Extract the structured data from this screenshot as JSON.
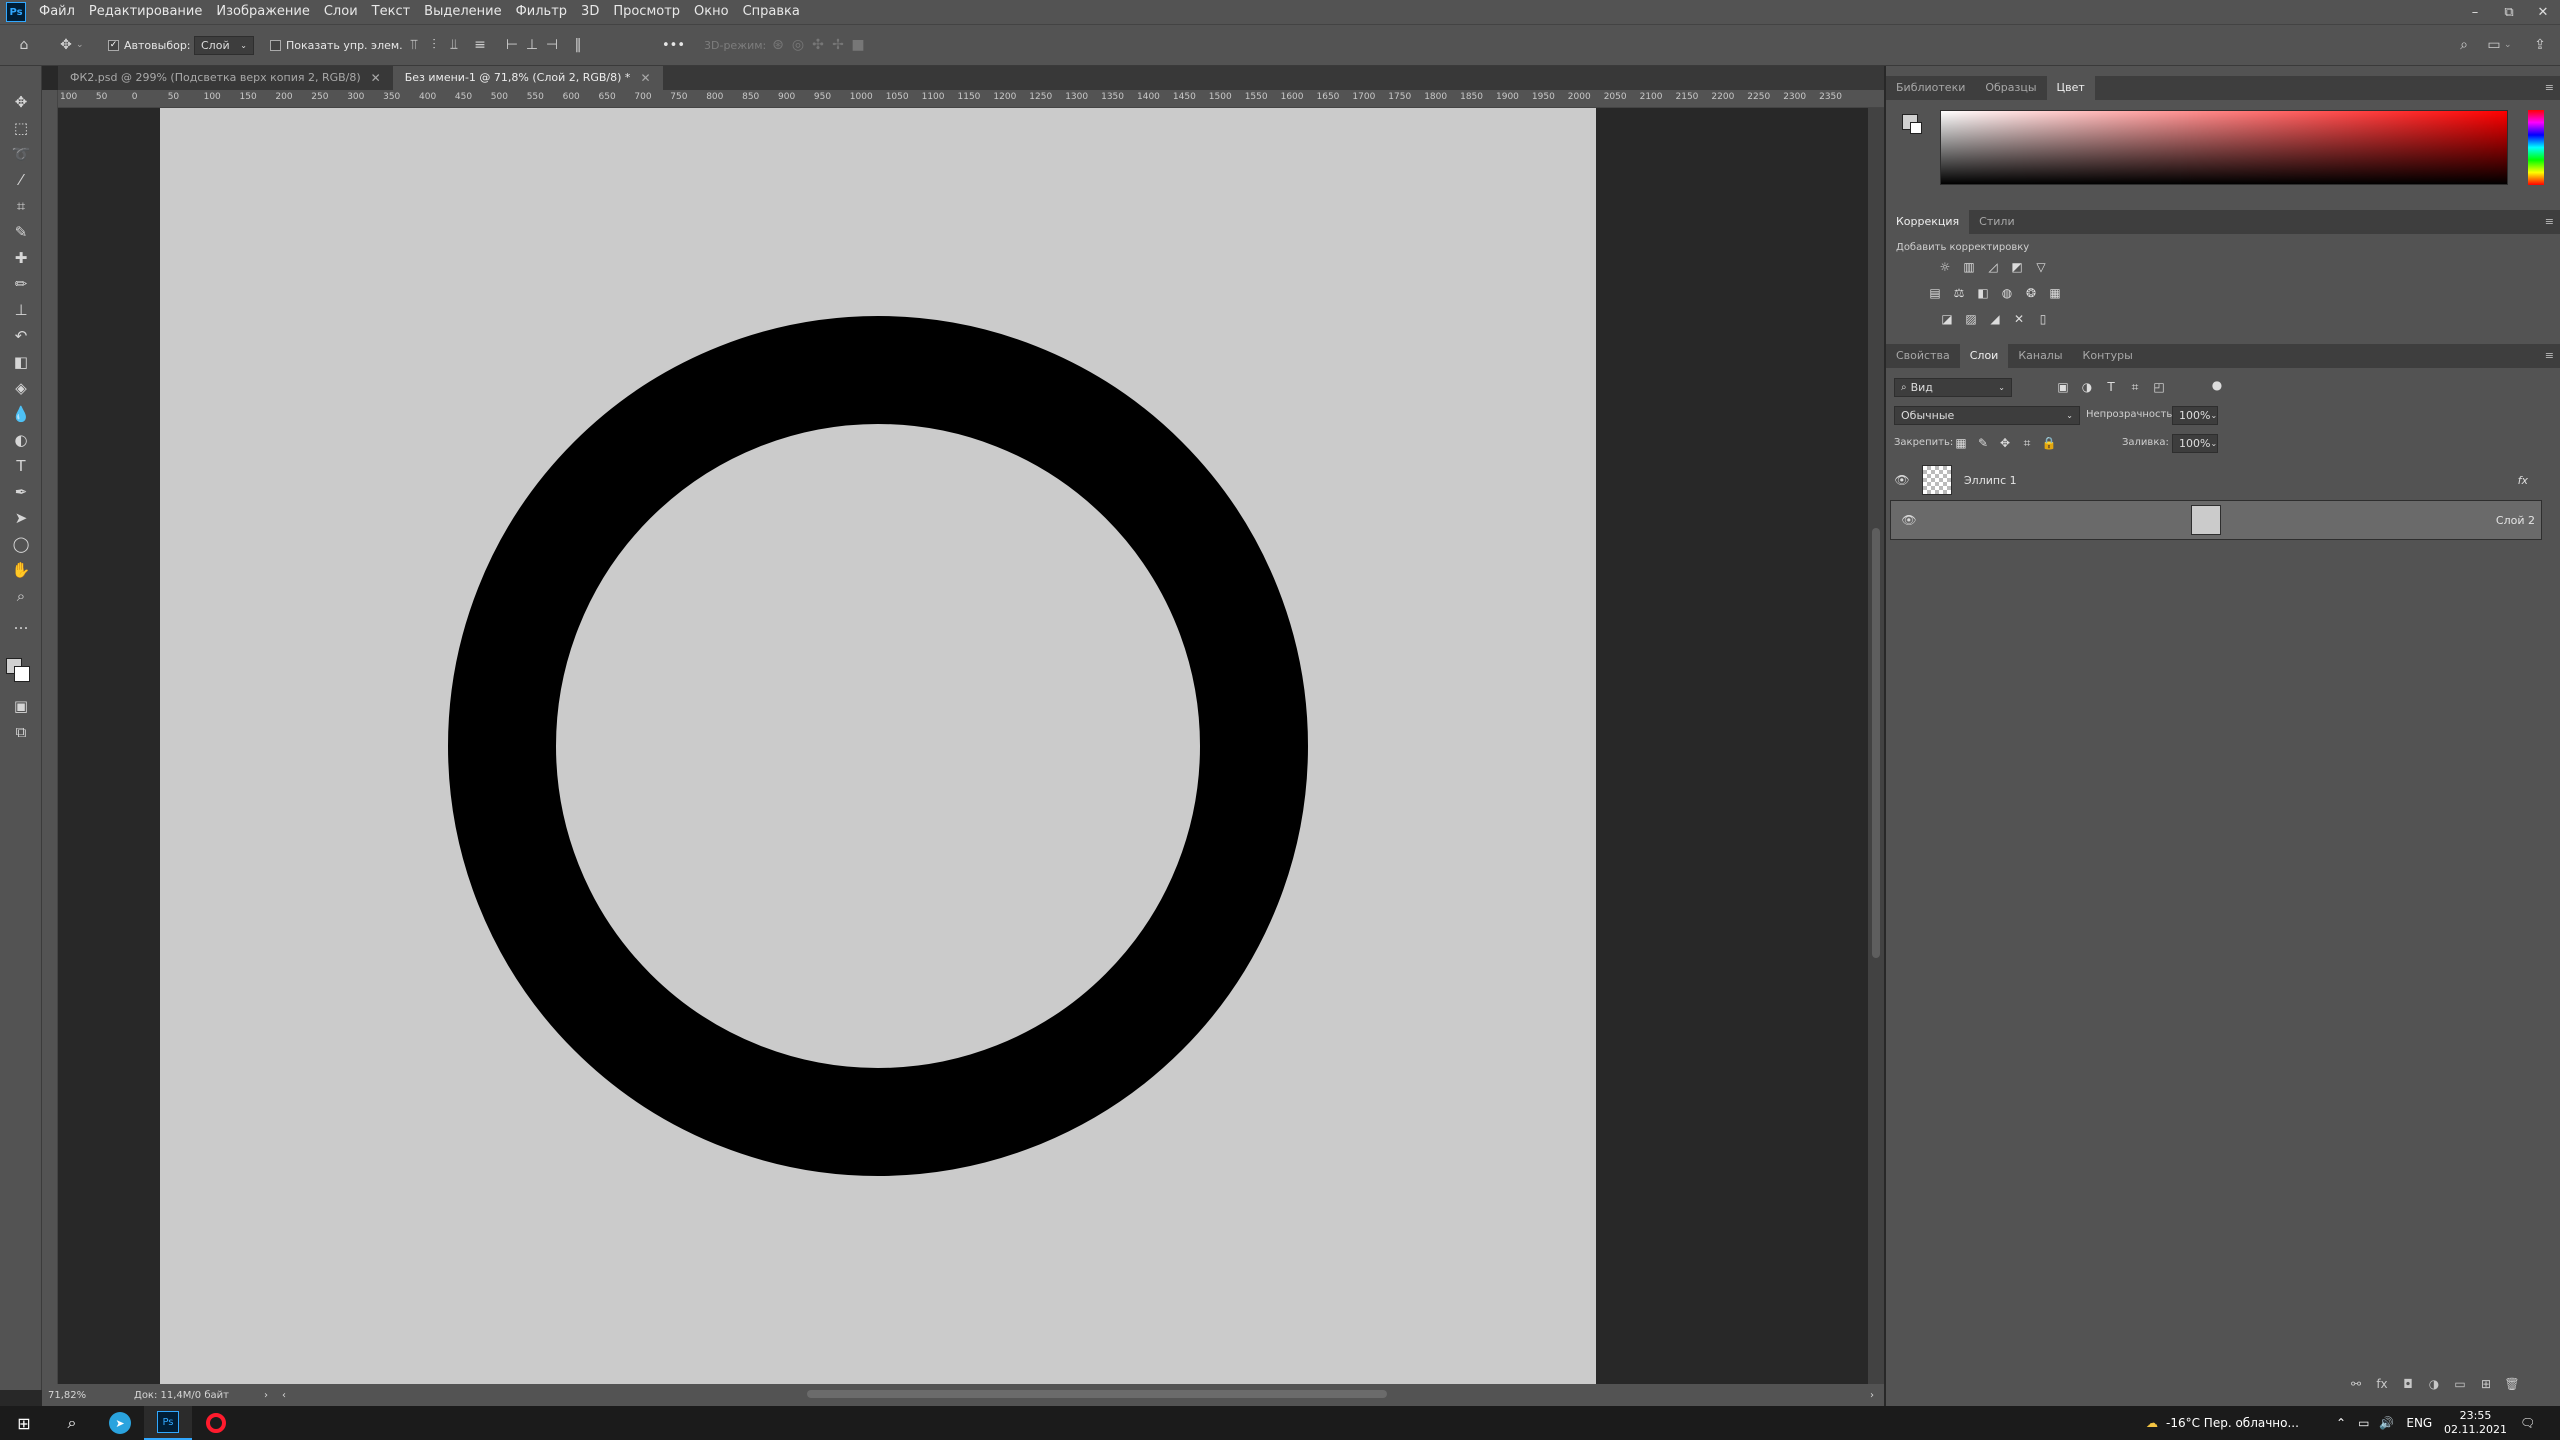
{
  "app": {
    "logo": "Ps",
    "accent": "#31a8ff"
  },
  "menu": [
    "Файл",
    "Редактирование",
    "Изображение",
    "Слои",
    "Текст",
    "Выделение",
    "Фильтр",
    "3D",
    "Просмотр",
    "Окно",
    "Справка"
  ],
  "window_controls": {
    "minimize": "–",
    "restore": "⧉",
    "close": "✕"
  },
  "options": {
    "autoselect_label": "Автовыбор:",
    "autoselect_checked": true,
    "autoselect_value": "Слой",
    "show_transform_label": "Показать упр. элем.",
    "more": "•••",
    "mode_3d": "3D-режим:"
  },
  "tabs": [
    {
      "label": "ФК2.psd @ 299% (Подсветка верх копия 2, RGB/8)",
      "active": false,
      "close": "✕"
    },
    {
      "label": "Без имени-1 @ 71,8% (Слой 2, RGB/8) *",
      "active": true,
      "close": "✕"
    }
  ],
  "ruler_h": [
    "100",
    "50",
    "0",
    "50",
    "100",
    "150",
    "200",
    "250",
    "300",
    "350",
    "400",
    "450",
    "500",
    "550",
    "600",
    "650",
    "700",
    "750",
    "800",
    "850",
    "900",
    "950",
    "1000",
    "1050",
    "1100",
    "1150",
    "1200",
    "1250",
    "1300",
    "1350",
    "1400",
    "1450",
    "1500",
    "1550",
    "1600",
    "1650",
    "1700",
    "1750",
    "1800",
    "1850",
    "1900",
    "1950",
    "2000",
    "2050",
    "2100",
    "2150",
    "2200",
    "2250",
    "2300",
    "2350"
  ],
  "document": {
    "background": "#cbcbcb",
    "ring_color": "#000000"
  },
  "status": {
    "zoom": "71,82%",
    "doc": "Док: 11,4M/0 байт",
    "arrow": "›",
    "left": "‹",
    "right": "›"
  },
  "panels": {
    "color_tabs": [
      {
        "label": "Библиотеки",
        "active": false
      },
      {
        "label": "Образцы",
        "active": false
      },
      {
        "label": "Цвет",
        "active": true
      }
    ],
    "foreground": "#d0d0d0",
    "background_swatch": "#ffffff",
    "adjust_tabs": [
      {
        "label": "Коррекция",
        "active": true
      },
      {
        "label": "Стили",
        "active": false
      }
    ],
    "adjust_hint": "Добавить корректировку",
    "layer_tabs": [
      {
        "label": "Свойства",
        "active": false
      },
      {
        "label": "Слои",
        "active": true
      },
      {
        "label": "Каналы",
        "active": false
      },
      {
        "label": "Контуры",
        "active": false
      }
    ],
    "filter_kind": "Вид",
    "blend_mode": "Обычные",
    "opacity_label": "Непрозрачность:",
    "opacity_value": "100%",
    "lock_label": "Закрепить:",
    "fill_label": "Заливка:",
    "fill_value": "100%",
    "layers": [
      {
        "name": "Эллипс 1",
        "fx": "fx",
        "selected": false
      },
      {
        "name": "Слой 2",
        "selected": true
      }
    ]
  },
  "taskbar": {
    "weather": "-16°C Пер. облачно...",
    "lang": "ENG",
    "time": "23:55",
    "date": "02.11.2021"
  }
}
